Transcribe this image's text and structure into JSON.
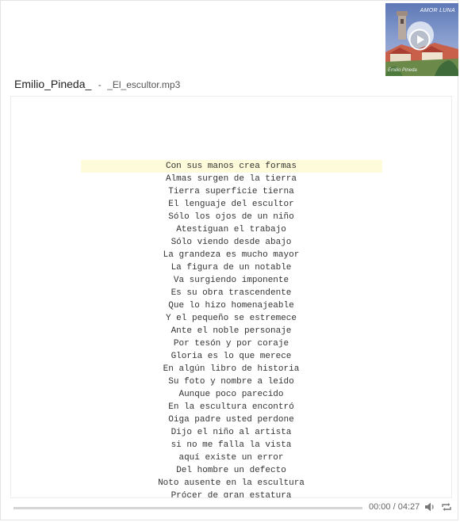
{
  "cover": {
    "title": "AMOR LUNA",
    "artist": "Emilio Pineda",
    "icon": "play-circle-icon"
  },
  "track": {
    "artist": "Emilio_Pineda_",
    "separator": "-",
    "file": "_El_escultor.mp3"
  },
  "lyrics": [
    "Con sus manos crea formas",
    "Almas surgen de la tierra",
    "Tierra superficie tierna",
    "El lenguaje del escultor",
    "Sólo los ojos de un niño",
    "Atestiguan el trabajo",
    "Sólo viendo desde abajo",
    "La grandeza es mucho mayor",
    "La figura de un notable",
    "Va surgiendo imponente",
    "Es su obra trascendente",
    "Que lo hizo homenajeable",
    "Y el pequeño se estremece",
    "Ante el noble personaje",
    "Por tesón y por coraje",
    "Gloria es lo que merece",
    "En algún libro de historia",
    "Su foto y nombre a leído",
    "Aunque poco parecido",
    "En la escultura encontró",
    "Oiga padre usted perdone",
    "Dijo el niño al artista",
    "si no me falla la vista",
    "aquí existe un error",
    "Del hombre un defecto",
    "Noto ausente en la escultura",
    "Prócer de gran estatura"
  ],
  "current_line": 0,
  "controls": {
    "time": "00:00 / 04:27",
    "progress": 0.0,
    "volume_icon": "volume-icon",
    "repeat_icon": "repeat-icon"
  },
  "colors": {
    "highlight": "#fdfbd9",
    "progress_track": "#d5d5d5",
    "icon": "#777777"
  }
}
